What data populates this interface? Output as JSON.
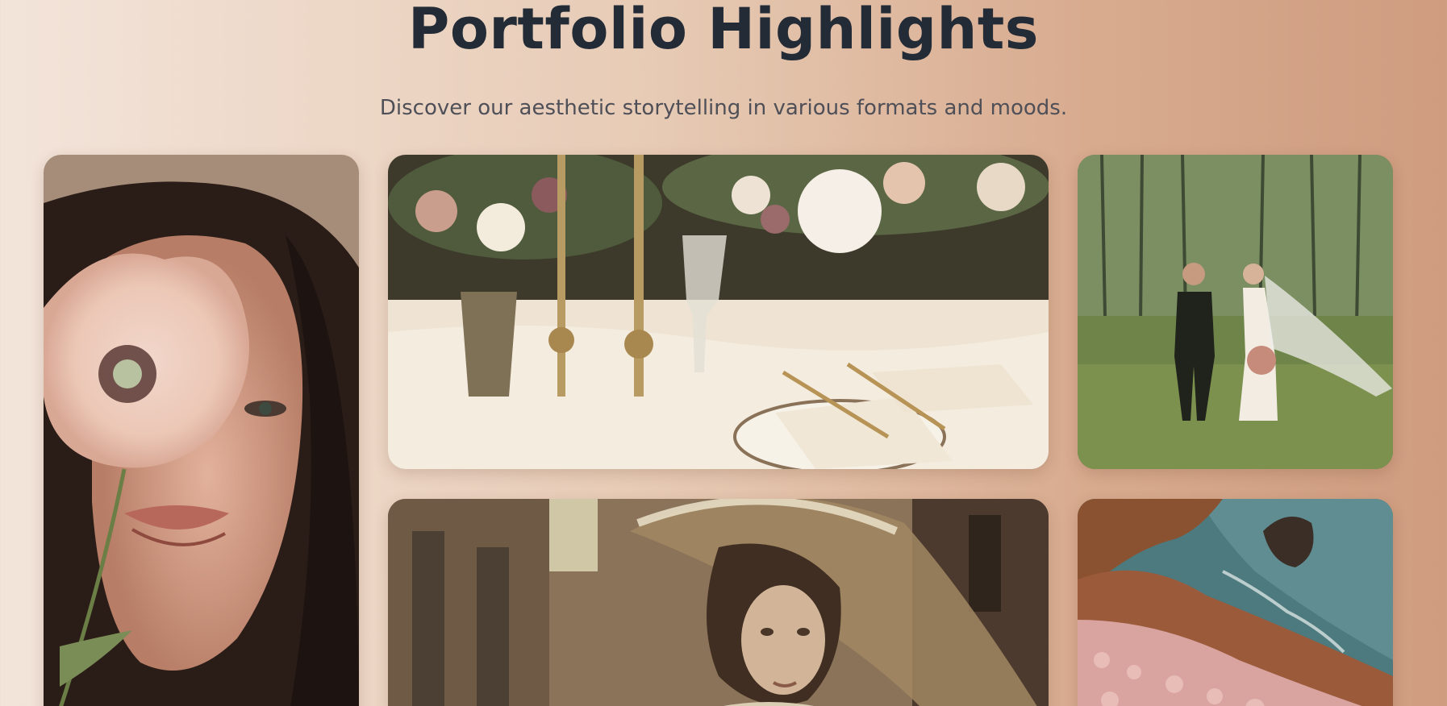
{
  "header": {
    "title": "Portfolio Highlights",
    "subtitle": "Discover our aesthetic storytelling in various formats and moods."
  },
  "colors": {
    "title": "#222b36",
    "subtitle": "#4f4f58",
    "background_start": "#f3e4da",
    "background_end": "#cf9c7f"
  },
  "gallery": {
    "items": [
      {
        "name": "portrait-with-poppy-photo"
      },
      {
        "name": "wedding-table-setting-photo"
      },
      {
        "name": "couple-in-forest-photo"
      },
      {
        "name": "lady-with-lace-parasol-photo"
      },
      {
        "name": "coastal-cliffs-flowers-photo"
      }
    ]
  }
}
